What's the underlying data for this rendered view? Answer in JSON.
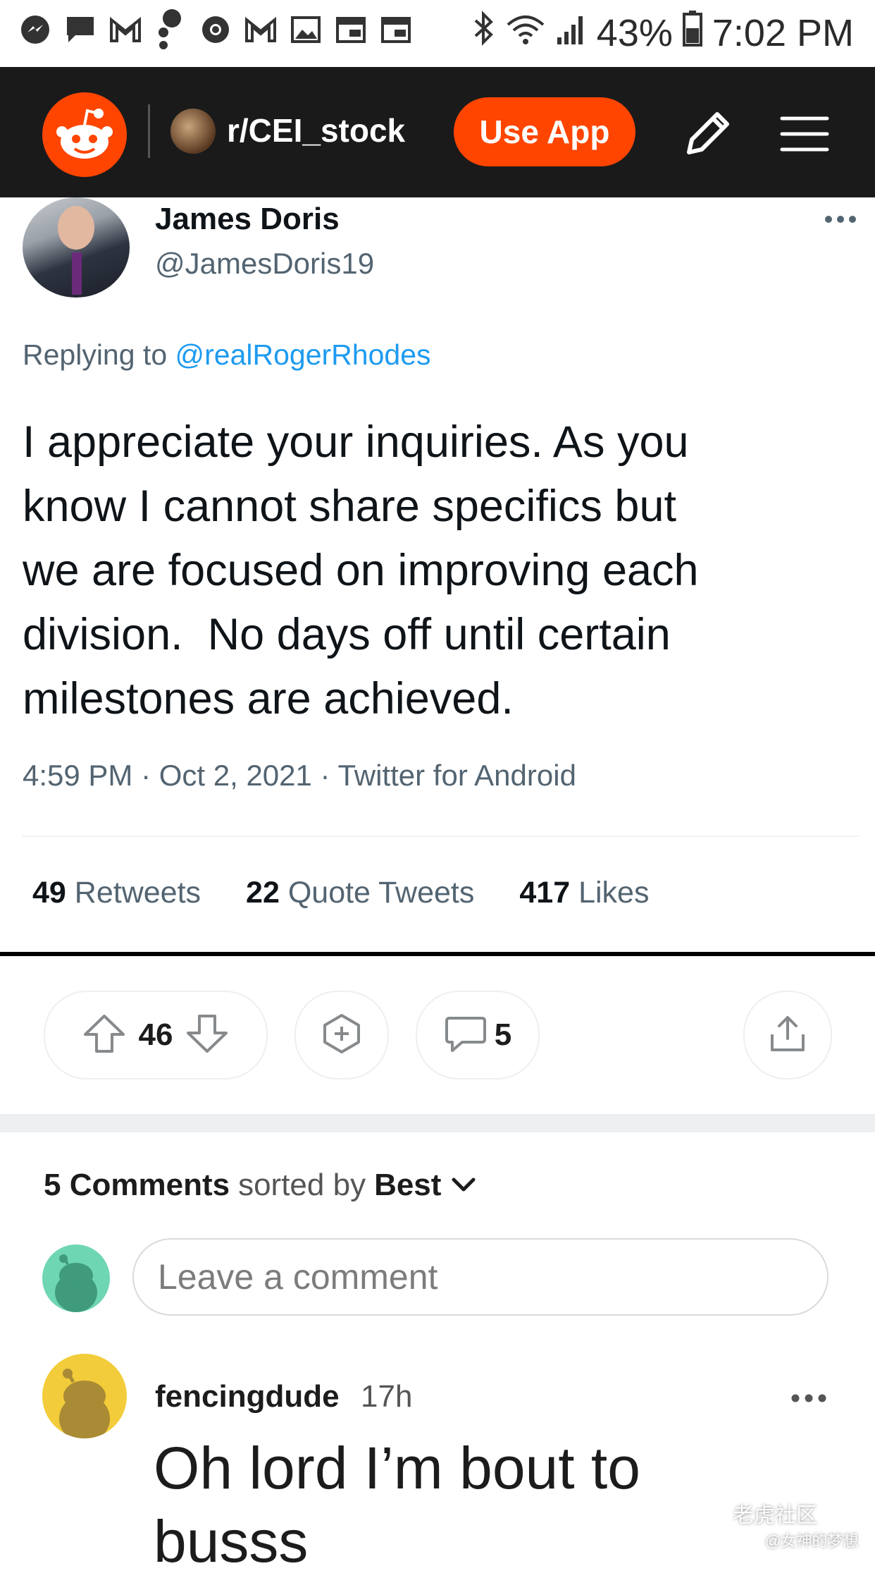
{
  "status_bar": {
    "battery": "43%",
    "time": "7:02 PM",
    "notification_icons": [
      "messenger-icon",
      "chat-icon",
      "gmail-icon",
      "assistant-icon",
      "chrome-icon",
      "gmail-icon",
      "gallery-icon",
      "calendar-icon",
      "calendar-icon"
    ],
    "system_icons": [
      "bluetooth-icon",
      "wifi-icon",
      "signal-icon",
      "battery-icon"
    ]
  },
  "topbar": {
    "subreddit": "r/CEI_stock",
    "use_app_label": "Use App",
    "brand_color": "#ff4500",
    "bg_color": "#1a1a1b"
  },
  "tweet": {
    "author_name": "James Doris",
    "author_handle": "@JamesDoris19",
    "replying_prefix": "Replying to ",
    "replying_handle": "@realRogerRhodes",
    "text": "I appreciate your inquiries. As you\nknow I cannot share specifics but\nwe are focused on improving each\ndivision.  No days off until certain\nmilestones are achieved.",
    "meta": "4:59 PM · Oct 2, 2021 · Twitter for Android",
    "retweets_count": "49",
    "retweets_label": " Retweets",
    "quotes_count": "22",
    "quotes_label": " Quote Tweets",
    "likes_count": "417",
    "likes_label": " Likes"
  },
  "post_actions": {
    "vote_count": "46",
    "comment_count": "5"
  },
  "comments": {
    "count_label": "5 Comments",
    "sorted_by": " sorted by ",
    "sort": "Best",
    "input_placeholder": "Leave a comment",
    "items": [
      {
        "user": "fencingdude",
        "age": "17h",
        "body": "Oh lord I’m bout to\nbusss"
      }
    ]
  },
  "watermark": {
    "line1": "老虎社区",
    "line2": "@女神的梦想"
  }
}
